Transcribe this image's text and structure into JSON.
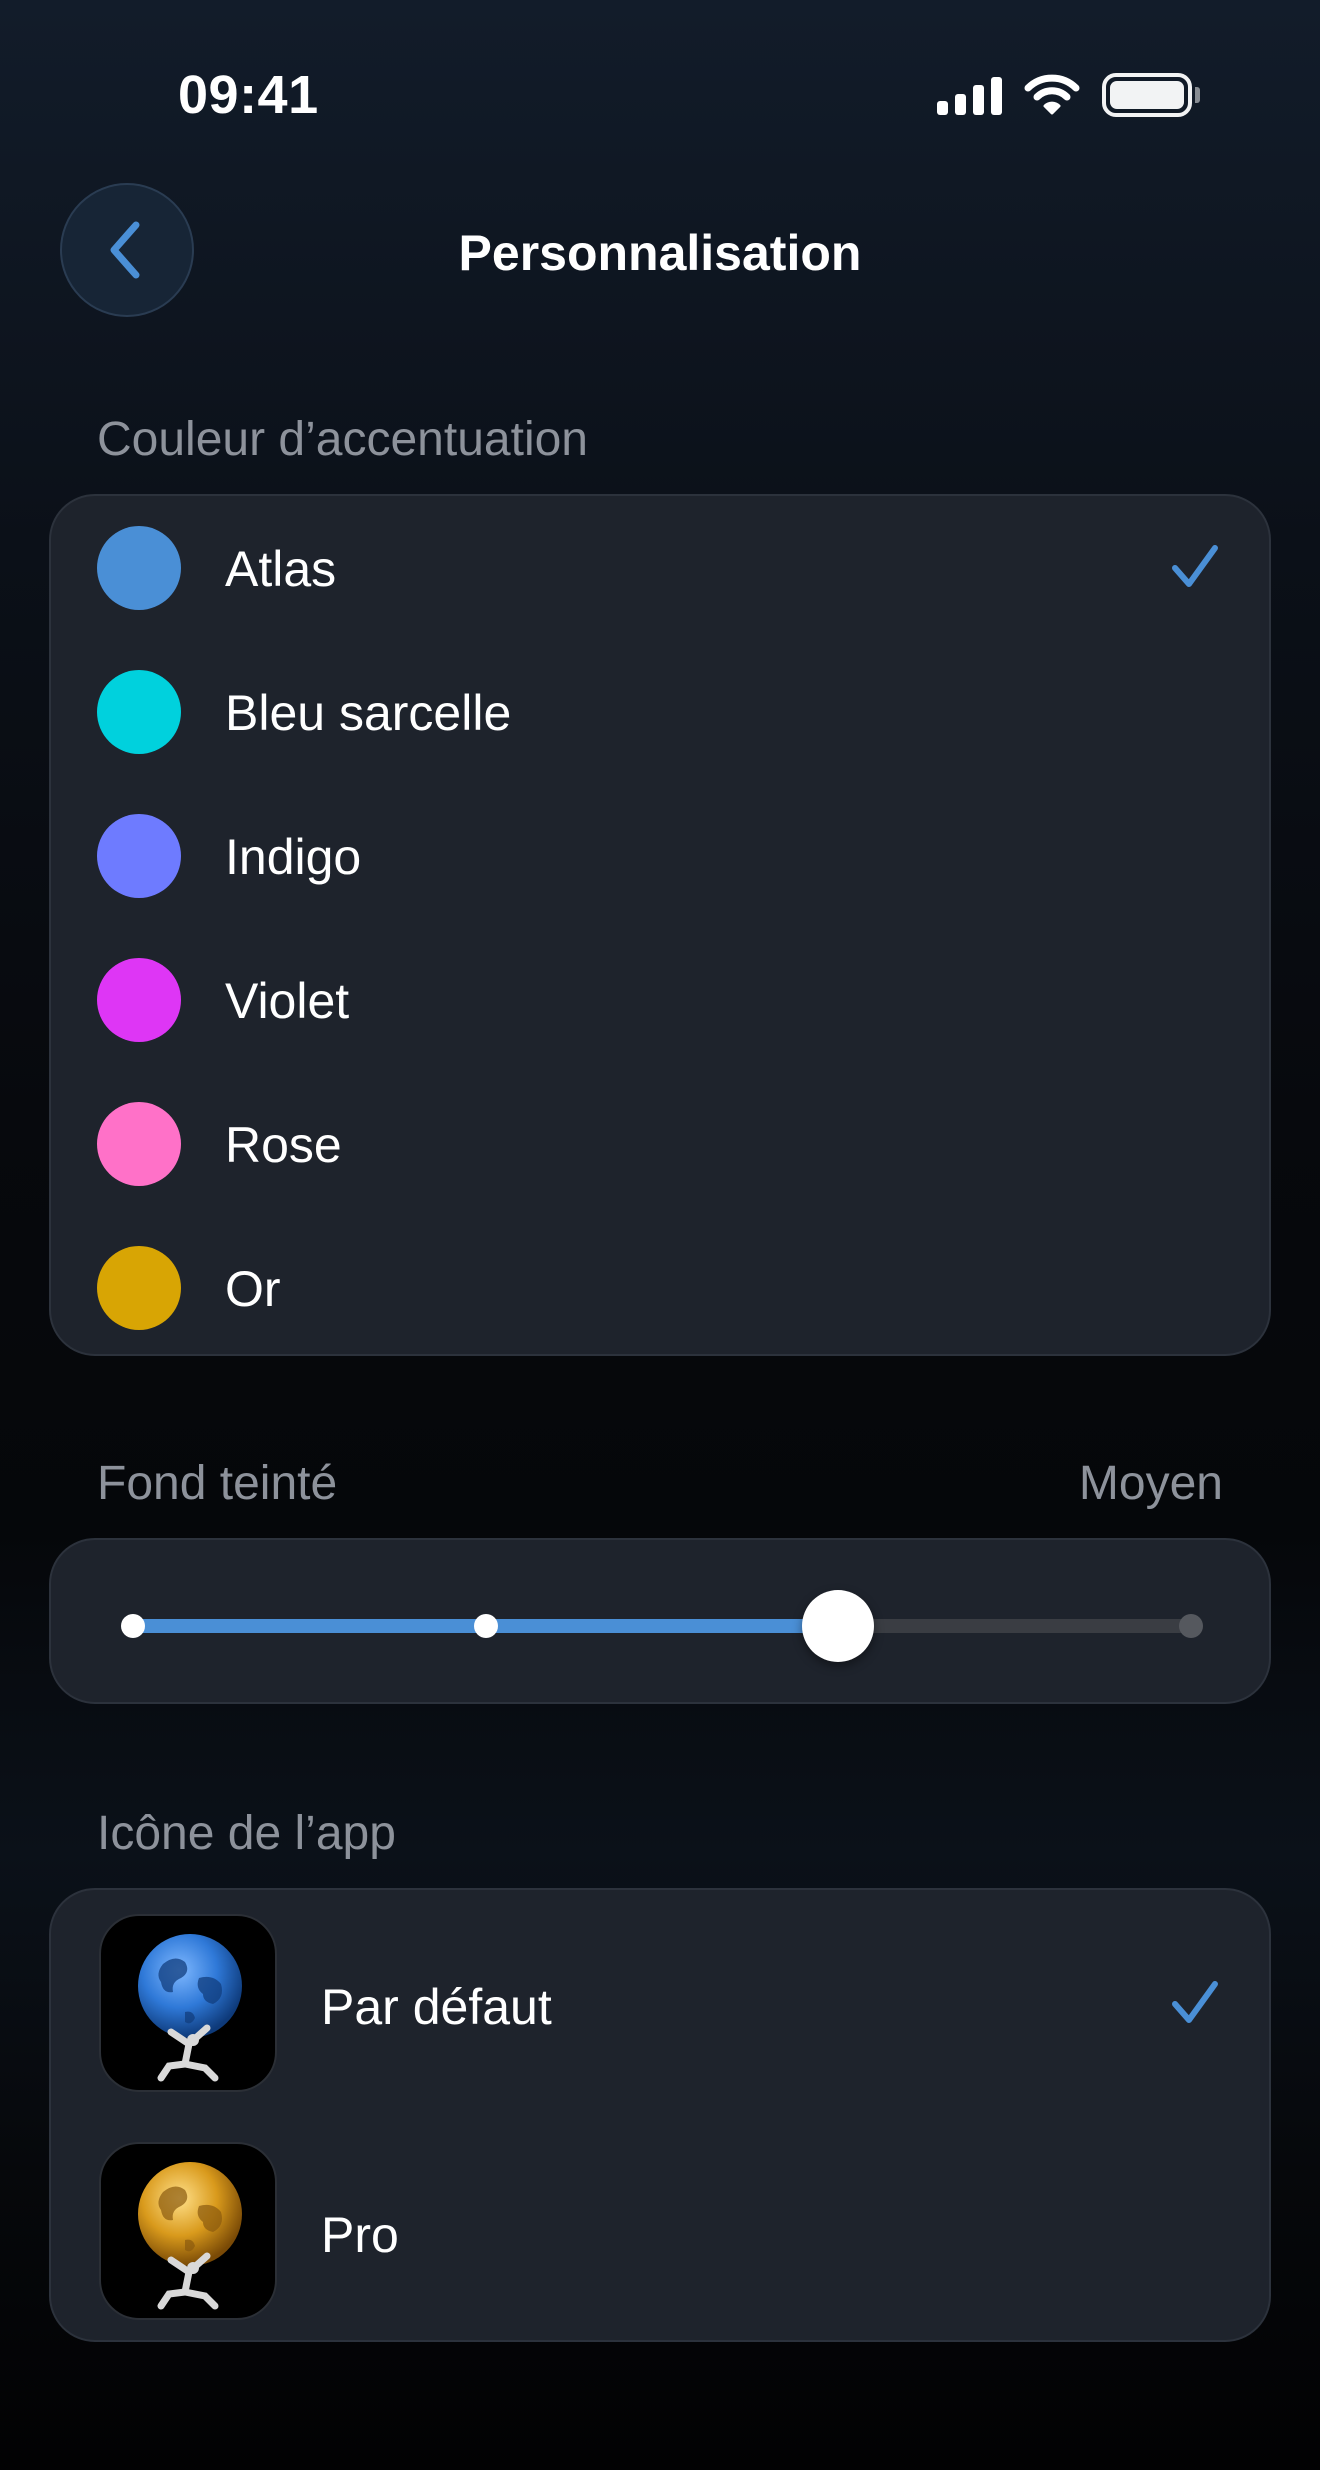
{
  "status_bar": {
    "time": "09:41"
  },
  "nav": {
    "title": "Personnalisation"
  },
  "accent": {
    "label": "Couleur d’accentuation",
    "options": [
      {
        "name": "Atlas",
        "color": "#4a8fd6",
        "selected": true
      },
      {
        "name": "Bleu sarcelle",
        "color": "#00d1dd",
        "selected": false
      },
      {
        "name": "Indigo",
        "color": "#6e7bff",
        "selected": false
      },
      {
        "name": "Violet",
        "color": "#de36f5",
        "selected": false
      },
      {
        "name": "Rose",
        "color": "#ff71c8",
        "selected": false
      },
      {
        "name": "Or",
        "color": "#d8a504",
        "selected": false
      }
    ]
  },
  "tint": {
    "label": "Fond teinté",
    "value_label": "Moyen",
    "stops": 4,
    "selected_index": 2,
    "level": 0.667
  },
  "app_icon": {
    "label": "Icône de l’app",
    "options": [
      {
        "name": "Par défaut",
        "icon": "globe-atlas-blue-icon",
        "globe_color": "#2f79d8",
        "selected": true
      },
      {
        "name": "Pro",
        "icon": "globe-atlas-gold-icon",
        "globe_color": "#d99a1c",
        "selected": false
      }
    ]
  },
  "colors": {
    "accent": "#4a8fd6",
    "card": "#1e232c",
    "secondary_text": "#8d929b"
  }
}
